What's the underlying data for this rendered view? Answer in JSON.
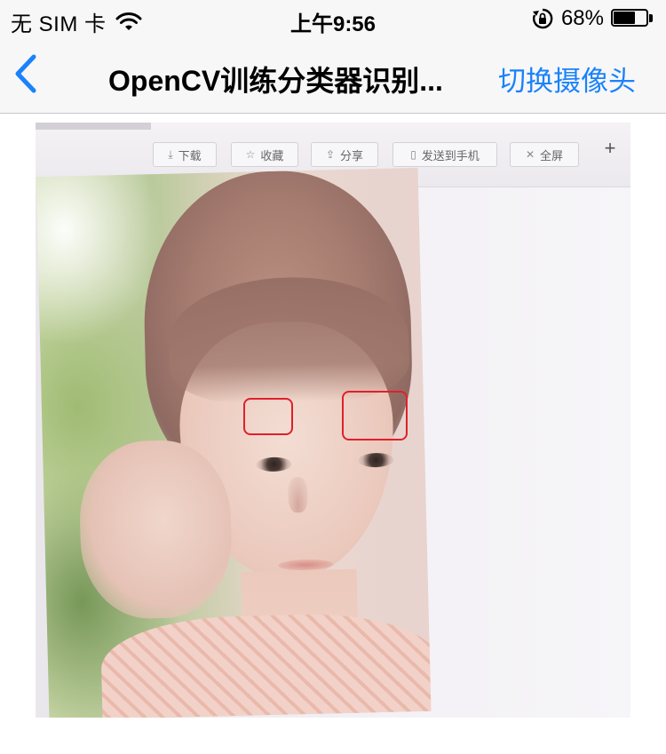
{
  "status_bar": {
    "carrier": "无 SIM 卡",
    "time": "上午9:56",
    "battery_percent_text": "68%",
    "battery_level": 0.68
  },
  "nav": {
    "title": "OpenCV训练分类器识别...",
    "right_button": "切换摄像头"
  },
  "camera_view": {
    "toolbar_buttons": [
      {
        "icon": "⤓",
        "label": "下载"
      },
      {
        "icon": "☆",
        "label": "收藏"
      },
      {
        "icon": "⇪",
        "label": "分享"
      },
      {
        "icon": "▯",
        "label": "发送到手机"
      },
      {
        "icon": "✕",
        "label": "全屏"
      }
    ],
    "toolbar_plus": "+",
    "detections_count": 2
  },
  "colors": {
    "accent": "#1a82fb",
    "detection_box": "#e0202a"
  }
}
